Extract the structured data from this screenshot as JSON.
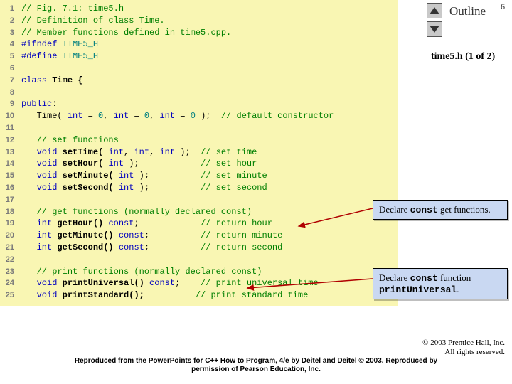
{
  "pageNumber": "6",
  "outlineLabel": "Outline",
  "subtitle": "time5.h (1 of 2)",
  "code": [
    {
      "n": "1",
      "segs": [
        {
          "t": "// Fig. 7.1: time5.h",
          "c": "c-green"
        }
      ]
    },
    {
      "n": "2",
      "segs": [
        {
          "t": "// Definition of class Time.",
          "c": "c-green"
        }
      ]
    },
    {
      "n": "3",
      "segs": [
        {
          "t": "// Member functions defined in time5.cpp.",
          "c": "c-green"
        }
      ]
    },
    {
      "n": "4",
      "segs": [
        {
          "t": "#ifndef",
          "c": "c-blue"
        },
        {
          "t": " ",
          "c": ""
        },
        {
          "t": "TIME5_H",
          "c": "c-cyan"
        }
      ]
    },
    {
      "n": "5",
      "segs": [
        {
          "t": "#define",
          "c": "c-blue"
        },
        {
          "t": " ",
          "c": ""
        },
        {
          "t": "TIME5_H",
          "c": "c-cyan"
        }
      ]
    },
    {
      "n": "6",
      "segs": [
        {
          "t": " ",
          "c": ""
        }
      ]
    },
    {
      "n": "7",
      "segs": [
        {
          "t": "class ",
          "c": "c-blue"
        },
        {
          "t": "Time {",
          "c": "c-black bold"
        }
      ]
    },
    {
      "n": "8",
      "segs": [
        {
          "t": " ",
          "c": ""
        }
      ]
    },
    {
      "n": "9",
      "segs": [
        {
          "t": "public",
          "c": "c-blue"
        },
        {
          "t": ":",
          "c": "c-black"
        }
      ]
    },
    {
      "n": "10",
      "segs": [
        {
          "t": "   Time( ",
          "c": "c-black"
        },
        {
          "t": "int",
          "c": "c-blue"
        },
        {
          "t": " = ",
          "c": "c-black"
        },
        {
          "t": "0",
          "c": "c-cyan"
        },
        {
          "t": ", ",
          "c": "c-black"
        },
        {
          "t": "int",
          "c": "c-blue"
        },
        {
          "t": " = ",
          "c": "c-black"
        },
        {
          "t": "0",
          "c": "c-cyan"
        },
        {
          "t": ", ",
          "c": "c-black"
        },
        {
          "t": "int",
          "c": "c-blue"
        },
        {
          "t": " = ",
          "c": "c-black"
        },
        {
          "t": "0",
          "c": "c-cyan"
        },
        {
          "t": " );  ",
          "c": "c-black"
        },
        {
          "t": "// default constructor",
          "c": "c-green"
        }
      ]
    },
    {
      "n": "11",
      "segs": [
        {
          "t": " ",
          "c": ""
        }
      ]
    },
    {
      "n": "12",
      "segs": [
        {
          "t": "   ",
          "c": ""
        },
        {
          "t": "// set functions",
          "c": "c-green"
        }
      ]
    },
    {
      "n": "13",
      "segs": [
        {
          "t": "   ",
          "c": ""
        },
        {
          "t": "void",
          "c": "c-blue"
        },
        {
          "t": " setTime( ",
          "c": "c-black bold"
        },
        {
          "t": "int",
          "c": "c-blue"
        },
        {
          "t": ", ",
          "c": "c-black"
        },
        {
          "t": "int",
          "c": "c-blue"
        },
        {
          "t": ", ",
          "c": "c-black"
        },
        {
          "t": "int",
          "c": "c-blue"
        },
        {
          "t": " );  ",
          "c": "c-black"
        },
        {
          "t": "// set time",
          "c": "c-green"
        }
      ]
    },
    {
      "n": "14",
      "segs": [
        {
          "t": "   ",
          "c": ""
        },
        {
          "t": "void",
          "c": "c-blue"
        },
        {
          "t": " setHour( ",
          "c": "c-black bold"
        },
        {
          "t": "int",
          "c": "c-blue"
        },
        {
          "t": " );            ",
          "c": "c-black"
        },
        {
          "t": "// set hour",
          "c": "c-green"
        }
      ]
    },
    {
      "n": "15",
      "segs": [
        {
          "t": "   ",
          "c": ""
        },
        {
          "t": "void",
          "c": "c-blue"
        },
        {
          "t": " setMinute( ",
          "c": "c-black bold"
        },
        {
          "t": "int",
          "c": "c-blue"
        },
        {
          "t": " );          ",
          "c": "c-black"
        },
        {
          "t": "// set minute",
          "c": "c-green"
        }
      ]
    },
    {
      "n": "16",
      "segs": [
        {
          "t": "   ",
          "c": ""
        },
        {
          "t": "void",
          "c": "c-blue"
        },
        {
          "t": " setSecond( ",
          "c": "c-black bold"
        },
        {
          "t": "int",
          "c": "c-blue"
        },
        {
          "t": " );          ",
          "c": "c-black"
        },
        {
          "t": "// set second",
          "c": "c-green"
        }
      ]
    },
    {
      "n": "17",
      "segs": [
        {
          "t": " ",
          "c": ""
        }
      ]
    },
    {
      "n": "18",
      "segs": [
        {
          "t": "   ",
          "c": ""
        },
        {
          "t": "// get functions (normally declared const)",
          "c": "c-green"
        }
      ]
    },
    {
      "n": "19",
      "segs": [
        {
          "t": "   ",
          "c": ""
        },
        {
          "t": "int",
          "c": "c-blue"
        },
        {
          "t": " getHour() ",
          "c": "c-black bold"
        },
        {
          "t": "const",
          "c": "c-blue"
        },
        {
          "t": ";            ",
          "c": "c-black"
        },
        {
          "t": "// return hour",
          "c": "c-green"
        }
      ]
    },
    {
      "n": "20",
      "segs": [
        {
          "t": "   ",
          "c": ""
        },
        {
          "t": "int",
          "c": "c-blue"
        },
        {
          "t": " getMinute() ",
          "c": "c-black bold"
        },
        {
          "t": "const",
          "c": "c-blue"
        },
        {
          "t": ";          ",
          "c": "c-black"
        },
        {
          "t": "// return minute",
          "c": "c-green"
        }
      ]
    },
    {
      "n": "21",
      "segs": [
        {
          "t": "   ",
          "c": ""
        },
        {
          "t": "int",
          "c": "c-blue"
        },
        {
          "t": " getSecond() ",
          "c": "c-black bold"
        },
        {
          "t": "const",
          "c": "c-blue"
        },
        {
          "t": ";          ",
          "c": "c-black"
        },
        {
          "t": "// return second",
          "c": "c-green"
        }
      ]
    },
    {
      "n": "22",
      "segs": [
        {
          "t": " ",
          "c": ""
        }
      ]
    },
    {
      "n": "23",
      "segs": [
        {
          "t": "   ",
          "c": ""
        },
        {
          "t": "// print functions (normally declared const)",
          "c": "c-green"
        }
      ]
    },
    {
      "n": "24",
      "segs": [
        {
          "t": "   ",
          "c": ""
        },
        {
          "t": "void",
          "c": "c-blue"
        },
        {
          "t": " printUniversal() ",
          "c": "c-black bold"
        },
        {
          "t": "const",
          "c": "c-blue"
        },
        {
          "t": ";    ",
          "c": "c-black"
        },
        {
          "t": "// print universal time",
          "c": "c-green"
        }
      ]
    },
    {
      "n": "25",
      "segs": [
        {
          "t": "   ",
          "c": ""
        },
        {
          "t": "void",
          "c": "c-blue"
        },
        {
          "t": " printStandard();          ",
          "c": "c-black bold"
        },
        {
          "t": "// print standard time",
          "c": "c-green"
        }
      ]
    }
  ],
  "callout1": {
    "pre": "Declare ",
    "mono": "const",
    "post": " get functions."
  },
  "callout2": {
    "pre": "Declare ",
    "mono1": "const",
    "mid": " function ",
    "mono2": "printUniversal",
    "post": "."
  },
  "copyright": {
    "line1": "© 2003 Prentice Hall, Inc.",
    "line2": "All rights reserved."
  },
  "repro": {
    "line1": "Reproduced from the PowerPoints for C++ How to Program, 4/e by Deitel and Deitel © 2003. Reproduced by",
    "line2": "permission of Pearson Education, Inc."
  }
}
